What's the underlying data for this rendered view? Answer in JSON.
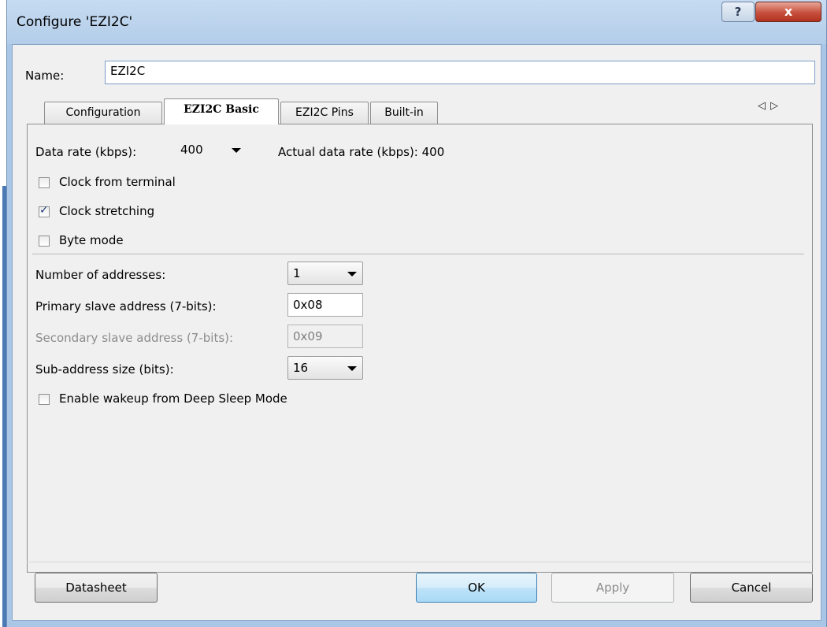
{
  "window": {
    "title": "Configure 'EZI2C'",
    "help_label": "?",
    "close_label": "x"
  },
  "name_field": {
    "label": "Name:",
    "value": "EZI2C"
  },
  "tabs": [
    {
      "label": "Configuration",
      "active": false
    },
    {
      "label": "EZI2C Basic",
      "active": true
    },
    {
      "label": "EZI2C Pins",
      "active": false
    },
    {
      "label": "Built-in",
      "active": false
    }
  ],
  "tab_scroll": {
    "left": "◁",
    "right": "▷"
  },
  "basic": {
    "data_rate_label": "Data rate (kbps):",
    "data_rate_value": "400",
    "actual_rate_text": "Actual data rate (kbps): 400",
    "clock_from_terminal": {
      "label": "Clock from terminal",
      "checked": false
    },
    "clock_stretching": {
      "label": "Clock stretching",
      "checked": true
    },
    "byte_mode": {
      "label": "Byte mode",
      "checked": false
    },
    "num_addresses_label": "Number of addresses:",
    "num_addresses_value": "1",
    "primary_addr_label": "Primary slave address (7-bits):",
    "primary_addr_value": "0x08",
    "secondary_addr_label": "Secondary slave address (7-bits):",
    "secondary_addr_value": "0x09",
    "subaddr_label": "Sub-address size (bits):",
    "subaddr_value": "16",
    "wakeup": {
      "label": "Enable wakeup from Deep Sleep Mode",
      "checked": false
    }
  },
  "buttons": {
    "datasheet": "Datasheet",
    "ok": "OK",
    "apply": "Apply",
    "cancel": "Cancel"
  },
  "check_mark": "✓"
}
